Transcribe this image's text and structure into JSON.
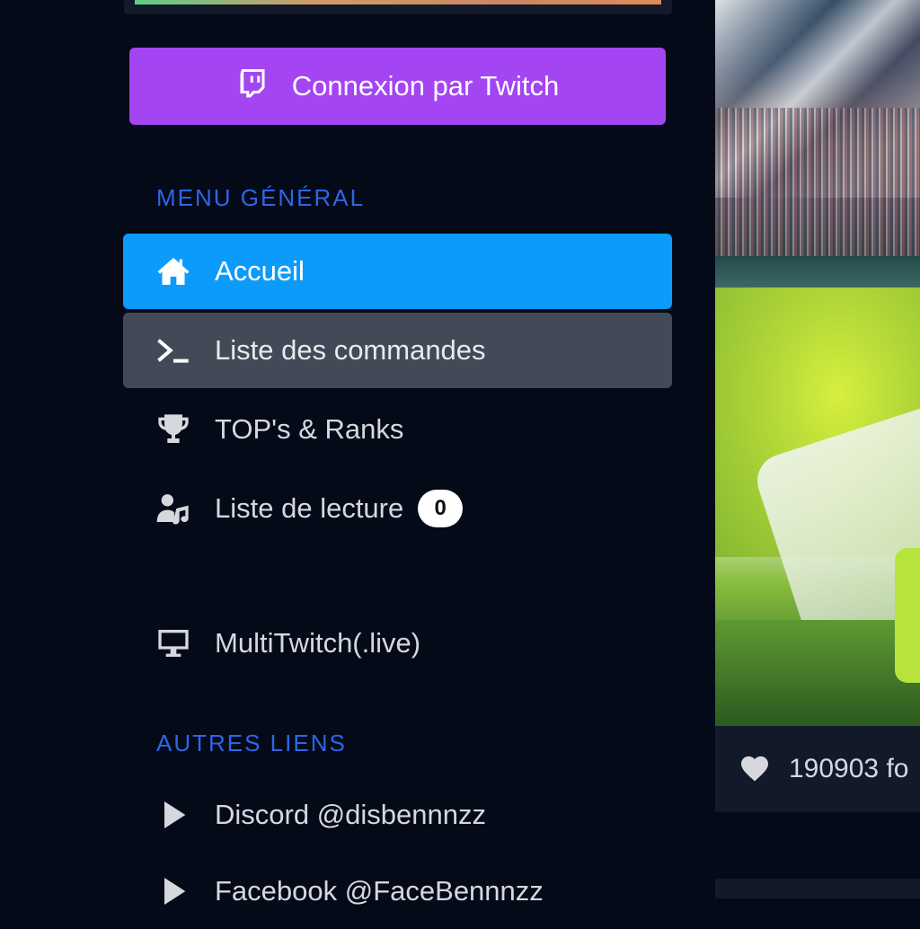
{
  "login": {
    "label": "Connexion par Twitch"
  },
  "sections": {
    "general": "MENU GÉNÉRAL",
    "other": "AUTRES LIENS"
  },
  "menu": {
    "home": "Accueil",
    "commands": "Liste des commandes",
    "tops": "TOP's & Ranks",
    "playlist": "Liste de lecture",
    "playlist_count": "0",
    "multitwitch": "MultiTwitch(.live)"
  },
  "links": {
    "discord": "Discord @disbennnzz",
    "facebook": "Facebook @FaceBennnzz"
  },
  "media": {
    "likes": "190903 fo"
  },
  "colors": {
    "twitch_purple": "#a445f3",
    "active_blue": "#0d9bfb",
    "section_blue": "#2d66e6",
    "background": "#040a18"
  }
}
